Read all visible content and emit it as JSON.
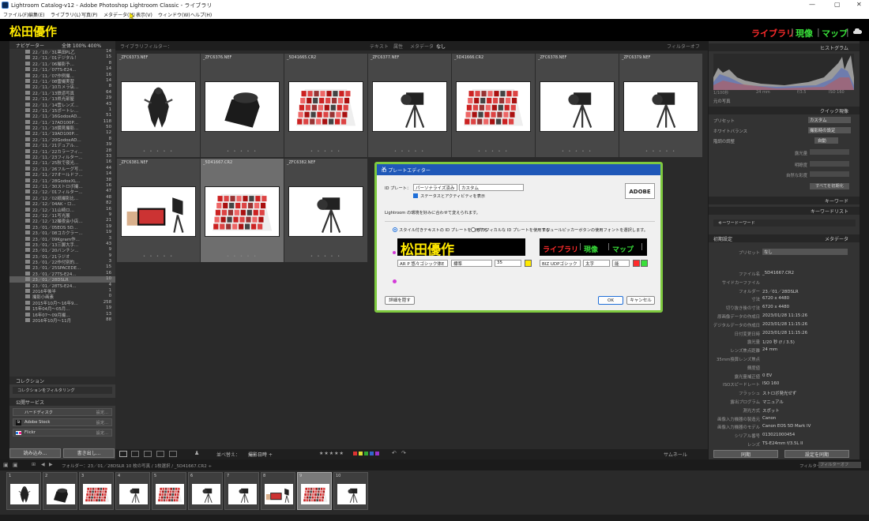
{
  "window": {
    "title": "Lightroom Catalog-v12 - Adobe Photoshop Lightroom Classic - ライブラリ",
    "min": "—",
    "max": "▢",
    "close": "✕"
  },
  "menu": [
    "ファイル(F)",
    "編集(E)",
    "ライブラリ(L)",
    "写真(P)",
    "メタデータ(M)",
    "表示(V)",
    "ウィンドウ(W)",
    "ヘルプ(H)"
  ],
  "identity": {
    "plate": "松田優作",
    "modules": [
      {
        "label": "ライブラリ",
        "color": "#ff2b2b"
      },
      {
        "label": "現像",
        "color": "#39e03a"
      },
      {
        "label": "マップ",
        "color": "#39e03a"
      }
    ],
    "cloud_icon": "cloud-icon"
  },
  "left": {
    "navigator": {
      "title": "ナビゲーター",
      "zoom": "全体  100%  400%"
    },
    "folders": [
      {
        "n": "22／10／31黒田PL乙",
        "c": "14"
      },
      {
        "n": "22／11／01デジタル！",
        "c": "15"
      },
      {
        "n": "22／11／06撮影予…",
        "c": "8"
      },
      {
        "n": "22／11／07TS-E24…",
        "c": "14"
      },
      {
        "n": "22／11／07作例撮…",
        "c": "16"
      },
      {
        "n": "22／11／08雷撮実習",
        "c": "14"
      },
      {
        "n": "22／11／10カメラ店…",
        "c": "8"
      },
      {
        "n": "22／11／13鉄道写真",
        "c": "64"
      },
      {
        "n": "22／11／13県光部屋",
        "c": "29"
      },
      {
        "n": "22／11／14雲レンズ…",
        "c": "43"
      },
      {
        "n": "22／11／15ポートレ…",
        "c": "1"
      },
      {
        "n": "22／11／16GodoxAD…",
        "c": "51"
      },
      {
        "n": "22／11／17AD100P…",
        "c": "118"
      },
      {
        "n": "22／11／18鏡見撮影…",
        "c": "50"
      },
      {
        "n": "22／11／19AD100P…",
        "c": "12"
      },
      {
        "n": "22／11／20GodoxAD…",
        "c": "8"
      },
      {
        "n": "22／11／21デュアル…",
        "c": "39"
      },
      {
        "n": "22／11／22カラーフィ…",
        "c": "28"
      },
      {
        "n": "22／11／23フィルター…",
        "c": "33"
      },
      {
        "n": "22／11／25秋で夜光…",
        "c": "16"
      },
      {
        "n": "22／11／26フルーグ写…",
        "c": "44"
      },
      {
        "n": "22／11／27オールドフ…",
        "c": "14"
      },
      {
        "n": "22／11／28GodoxXL…",
        "c": "38"
      },
      {
        "n": "22／11／30ストロボ撮…",
        "c": "16"
      },
      {
        "n": "22／12／01フィルター…",
        "c": "47"
      },
      {
        "n": "22／12／02紙撮影比…",
        "c": "48"
      },
      {
        "n": "22／12／04AK・ロ…",
        "c": "82"
      },
      {
        "n": "22／12／11山崎ロ…",
        "c": "16"
      },
      {
        "n": "22／12／11写光展",
        "c": "9"
      },
      {
        "n": "22／12／12撮夜会小店…",
        "c": "21"
      },
      {
        "n": "23／01／05EOS 5D…",
        "c": "19"
      },
      {
        "n": "23／01／08コカクラー…",
        "c": "19"
      },
      {
        "n": "23／01／09Kgram作…",
        "c": "3"
      },
      {
        "n": "23／01／13三脚大手…",
        "c": "43"
      },
      {
        "n": "23／01／20バンチン…",
        "c": "9"
      },
      {
        "n": "23／01／21ラジオ",
        "c": "9"
      },
      {
        "n": "23／01／22作付別的…",
        "c": "3"
      },
      {
        "n": "23／01／25SPACEDE…",
        "c": "15"
      },
      {
        "n": "23／01／27TS-E24…",
        "c": "16"
      },
      {
        "n": "23／01／28DSLR",
        "c": "10",
        "sel": true
      },
      {
        "n": "23／01／28TS-E24…",
        "c": "4"
      },
      {
        "n": "2016年後半",
        "c": "1"
      },
      {
        "n": "撮影小画素",
        "c": "0"
      },
      {
        "n": "2015年10月〜16年9…",
        "c": "258"
      },
      {
        "n": "15年04月〜05月…",
        "c": "19"
      },
      {
        "n": "16年07〜09月撮…",
        "c": "13"
      },
      {
        "n": "2016年10月〜11月",
        "c": "88"
      }
    ],
    "collections": {
      "title": "コレクション",
      "filter": "コレクションをフィルタリング"
    },
    "publish": {
      "title": "公開サービス",
      "items": [
        {
          "label": "ハードディスク",
          "btn": "設定..."
        },
        {
          "label": "Adobe Stock",
          "btn": "設定..."
        },
        {
          "label": "Flickr",
          "btn": "設定..."
        }
      ]
    },
    "import_btn": "読み込み...",
    "export_btn": "書き出し..."
  },
  "grid": {
    "filter_label": "ライブラリフィルター：",
    "filter_tabs": [
      "テキスト",
      "属性",
      "メタデータ",
      "なし"
    ],
    "filter_off": "フィルターオフ",
    "cells": [
      {
        "name": "_ZFC6373.NEF",
        "kind": "figure"
      },
      {
        "name": "_ZFC6376.NEF",
        "kind": "lens"
      },
      {
        "name": "_5D41665.CR2",
        "kind": "grid"
      },
      {
        "name": "_ZFC6377.NEF",
        "kind": "camera"
      },
      {
        "name": "_5D41666.CR2",
        "kind": "grid"
      },
      {
        "name": "_ZFC6378.NEF",
        "kind": "camera"
      },
      {
        "name": "_ZFC6379.NEF",
        "kind": "camera"
      },
      {
        "name": "_ZFC6381.NEF",
        "kind": "monitor"
      },
      {
        "name": "_5D41667.CR2",
        "kind": "grid",
        "sel": true
      },
      {
        "name": "_ZFC6382.NEF",
        "kind": "camera"
      }
    ]
  },
  "toolbar": {
    "sort_label": "並べ替え：",
    "sort_value": "撮影日時 ÷",
    "stars": "★★★★★",
    "thumbnails": "サムネール"
  },
  "right": {
    "histogram": "ヒストグラム",
    "hist_info": [
      "1/100秒",
      "24 mm",
      "f/3.5",
      "ISO 160"
    ],
    "original": "元の写真",
    "quick": "クイック現像",
    "preset": {
      "k": "プリセット",
      "v": "カスタム"
    },
    "wb": {
      "k": "ホワイトバランス",
      "v": "撮影時の設定"
    },
    "tone": {
      "k": "階調の調整",
      "v": "自動"
    },
    "exposure": "露光量",
    "clarity": "明瞭度",
    "vibrance": "自然な彩度",
    "reset": "すべてを初期化",
    "keyword": "キーワード",
    "keyword_list": "キーワードリスト",
    "keyword_filter": "キーワードーワード",
    "metadata": "メタデータ",
    "meta_default": "初期設定",
    "meta_preset": {
      "k": "プリセット",
      "v": "なし"
    },
    "meta_rows": [
      {
        "k": "ファイル名",
        "v": "_5D41667.CR2"
      },
      {
        "k": "サイドカーファイル",
        "v": ""
      },
      {
        "k": "フォルダー",
        "v": "23／01／28DSLR"
      },
      {
        "k": "寸法",
        "v": "6720 x 4480"
      },
      {
        "k": "切り抜き後の寸法",
        "v": "6720 x 4480"
      },
      {
        "k": "原画像データの作成日",
        "v": "2023/01/28 11:15:26"
      },
      {
        "k": "デジタルデータの作成日",
        "v": "2023/01/28 11:15:26"
      },
      {
        "k": "日付変更日時",
        "v": "2023/01/28 11:15:26"
      },
      {
        "k": "露光量",
        "v": "1/20 秒 (f / 3.5)"
      },
      {
        "k": "レンズ焦点距離",
        "v": "24 mm"
      },
      {
        "k": "35mm換算レンズ焦点",
        "v": ""
      },
      {
        "k": "輝度値",
        "v": ""
      },
      {
        "k": "露光量補正値",
        "v": "0 EV"
      },
      {
        "k": "ISOスピードレート",
        "v": "ISO 160"
      },
      {
        "k": "フラッシュ",
        "v": "ストロボ発光せず"
      },
      {
        "k": "露出プログラム",
        "v": "マニュアル"
      },
      {
        "k": "測光方式",
        "v": "スポット"
      },
      {
        "k": "画像入力機器の製造元",
        "v": "Canon"
      },
      {
        "k": "画像入力機器のモデル",
        "v": "Canon EOS 5D Mark IV"
      },
      {
        "k": "シリアル番号",
        "v": "013021000454"
      },
      {
        "k": "レンズ",
        "v": "TS-E24mm f/3.5L II"
      }
    ],
    "sync": "同期",
    "sync_settings": "設定を同期"
  },
  "filmhdr": {
    "path": "フォルダー：23／01／28DSLR   10 枚の写真 / 1枚選択 / _5D41667.CR2 ÷",
    "filter": "フィルター：",
    "filter_val": "フィルターオフ"
  },
  "filmstrip": [
    {
      "n": "1",
      "kind": "figure"
    },
    {
      "n": "2",
      "kind": "lens"
    },
    {
      "n": "3",
      "kind": "grid"
    },
    {
      "n": "4",
      "kind": "camera"
    },
    {
      "n": "5",
      "kind": "grid"
    },
    {
      "n": "6",
      "kind": "camera"
    },
    {
      "n": "7",
      "kind": "camera"
    },
    {
      "n": "8",
      "kind": "monitor"
    },
    {
      "n": "9",
      "kind": "grid",
      "sel": true
    },
    {
      "n": "10",
      "kind": "camera"
    }
  ],
  "dialog": {
    "title": "ID プレートエディター",
    "close": "✕",
    "plate_label": "ID プレート：",
    "plate_select": "パーソナライズ済み",
    "custom_select": "カスタム",
    "show_status": "ステータスとアクティビティを表示",
    "adobe_logo": "ADOBE",
    "note": "Lightroom の環境を好みに合わせて変えられます。",
    "radio_styled": "スタイル付きテキストの ID プレートを使用する",
    "radio_graphic": "グラフィカルな ID プレートを使用する",
    "module_note": "モジュールピッカーボタンの使用フォントを選択します。",
    "plate_preview": "松田優作",
    "font_left": "AR P 悠々ゴシック体E",
    "style_left": "標準",
    "size_left": "35",
    "module_preview": [
      "ライブラリ",
      "現像",
      "マップ"
    ],
    "font_right": "BIZ UDPゴシック",
    "style_right": "太字",
    "size_right": "能",
    "detail_btn": "詳細を隠す",
    "ok_btn": "OK",
    "cancel_btn": "キャンセル",
    "color_left": "#ffe900",
    "color_right1": "#ff2b2b",
    "color_right2": "#39e03a"
  }
}
